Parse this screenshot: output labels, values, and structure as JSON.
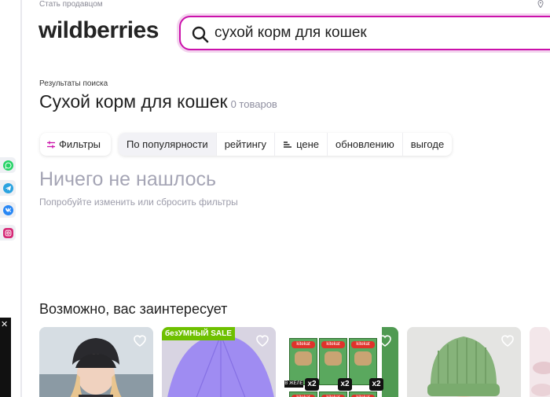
{
  "header": {
    "seller_link": "Стать продавцом",
    "logo": "wildberries",
    "search_value": "сухой корм для кошек",
    "geo_icon": "location-pin-icon"
  },
  "results": {
    "breadcrumb": "Результаты поиска",
    "title": "Сухой корм для кошек",
    "count": "0 товаров"
  },
  "toolbar": {
    "filters_label": "Фильтры",
    "sort_options": [
      "По популярности",
      "рейтингу",
      "цене",
      "обновлению",
      "выгоде"
    ]
  },
  "empty": {
    "title": "Ничего не нашлось",
    "subtitle": "Попробуйте изменить или сбросить фильтры"
  },
  "recommendations": {
    "title": "Возможно, вас заинтересует",
    "sale_badge": "безУМНЫЙ SALE",
    "multiplier": "x2",
    "brand": "kitekat",
    "side_label": "В ЖЕЛЕ"
  },
  "social": [
    "whatsapp-icon",
    "telegram-icon",
    "vk-icon",
    "instagram-icon"
  ],
  "colors": {
    "accent": "#cb11ab",
    "whatsapp": "#25d366",
    "telegram": "#2aa3e0",
    "vk": "#2787f5",
    "instagram": "#d62976",
    "sale": "#6ec000"
  }
}
